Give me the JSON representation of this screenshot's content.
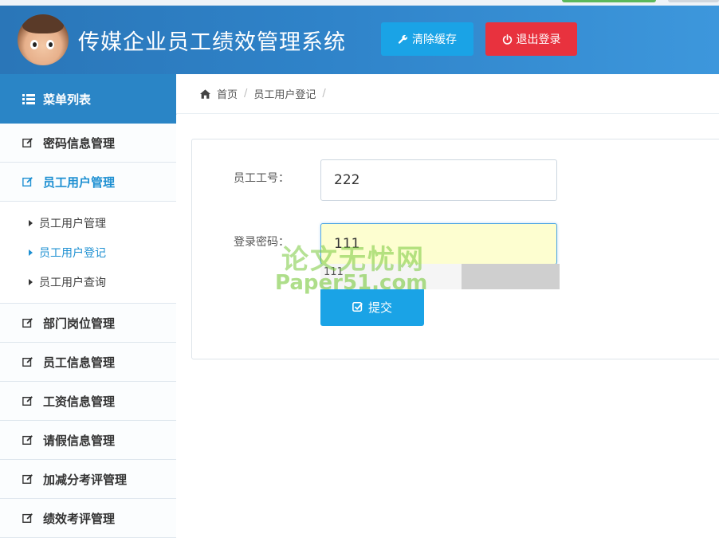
{
  "header": {
    "title": "传媒企业员工绩效管理系统",
    "clear_cache_label": "清除缓存",
    "logout_label": "退出登录"
  },
  "sidebar": {
    "title": "菜单列表",
    "items": [
      {
        "label": "密码信息管理"
      },
      {
        "label": "员工用户管理",
        "active": true
      },
      {
        "label": "部门岗位管理"
      },
      {
        "label": "员工信息管理"
      },
      {
        "label": "工资信息管理"
      },
      {
        "label": "请假信息管理"
      },
      {
        "label": "加减分考评管理"
      },
      {
        "label": "绩效考评管理"
      }
    ],
    "subitems": [
      {
        "label": "员工用户管理"
      },
      {
        "label": "员工用户登记",
        "active": true
      },
      {
        "label": "员工用户查询"
      }
    ]
  },
  "breadcrumb": {
    "home": "首页",
    "current": "员工用户登记"
  },
  "form": {
    "employee_id_label": "员工工号：",
    "employee_id_value": "222",
    "password_label": "登录密码：",
    "password_value": "111",
    "autocomplete_option": "111",
    "submit_label": "提交"
  },
  "watermark": {
    "line1": "论文无忧网",
    "line2": "Paper51.com"
  },
  "colors": {
    "header_bg": "#2f83c9",
    "accent_blue": "#1aa3e6",
    "danger_red": "#e8323e",
    "active_text": "#1e90d2"
  }
}
